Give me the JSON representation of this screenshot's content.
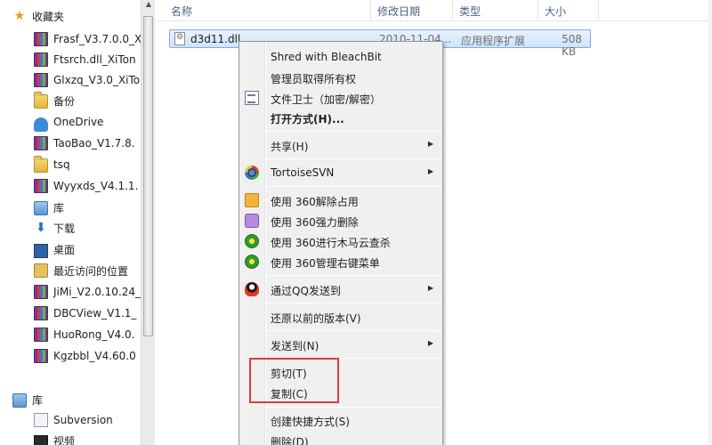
{
  "nav": {
    "favorites_label": "收藏夹",
    "items": [
      {
        "label": "Frasf_V3.7.0.0_X",
        "icon": "archive-icon"
      },
      {
        "label": "Ftsrch.dll_XiTon",
        "icon": "archive-icon"
      },
      {
        "label": "Glxzq_V3.0_XiTo",
        "icon": "archive-icon"
      },
      {
        "label": "备份",
        "icon": "folder-icon"
      },
      {
        "label": "OneDrive",
        "icon": "onedrive-icon"
      },
      {
        "label": "TaoBao_V1.7.8.",
        "icon": "archive-icon"
      },
      {
        "label": "tsq",
        "icon": "folder-icon"
      },
      {
        "label": "Wyyxds_V4.1.1.",
        "icon": "archive-icon"
      },
      {
        "label": "库",
        "icon": "library-icon"
      },
      {
        "label": "下载",
        "icon": "download-icon"
      },
      {
        "label": "桌面",
        "icon": "desktop-icon"
      },
      {
        "label": "最近访问的位置",
        "icon": "recent-places-icon"
      },
      {
        "label": "JiMi_V2.0.10.24_",
        "icon": "archive-icon"
      },
      {
        "label": "DBCView_V1.1_",
        "icon": "archive-icon"
      },
      {
        "label": "HuoRong_V4.0.",
        "icon": "archive-icon"
      },
      {
        "label": "Kgzbbl_V4.60.0",
        "icon": "archive-icon"
      }
    ],
    "library_label": "库",
    "library_items": [
      {
        "label": "Subversion",
        "icon": "svn-document-icon"
      },
      {
        "label": "视频",
        "icon": "video-icon"
      }
    ]
  },
  "columns": {
    "name": "名称",
    "date": "修改日期",
    "type": "类型",
    "size": "大小"
  },
  "file": {
    "name": "d3d11.dll",
    "date": "2010-11-04...",
    "type": "应用程序扩展",
    "size": "508 KB"
  },
  "context_menu": {
    "shred": "Shred with BleachBit",
    "take_ownership": "管理员取得所有权",
    "file_guard": "文件卫士（加密/解密）",
    "open_with": "打开方式(H)...",
    "share": "共享(H)",
    "tortoise": "TortoiseSVN",
    "unlock_360": "使用 360解除占用",
    "force_delete_360": "使用 360强力删除",
    "trojan_scan_360": "使用 360进行木马云查杀",
    "manage_menu_360": "使用 360管理右键菜单",
    "send_qq": "通过QQ发送到",
    "restore": "还原以前的版本(V)",
    "send_to": "发送到(N)",
    "cut": "剪切(T)",
    "copy": "复制(C)",
    "create_shortcut": "创建快捷方式(S)",
    "delete": "删除(D)"
  }
}
